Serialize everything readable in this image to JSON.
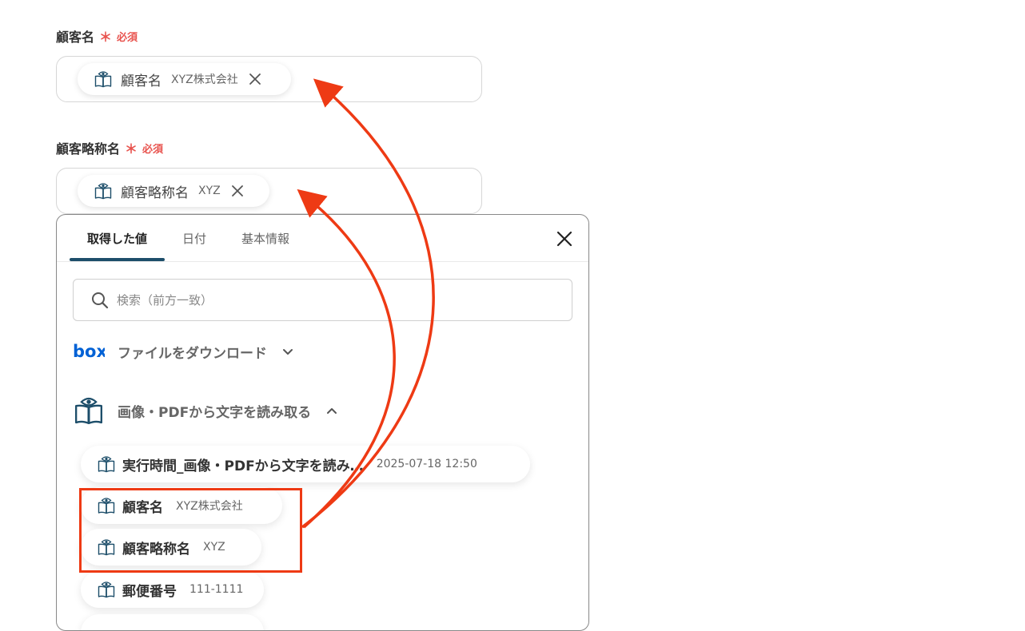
{
  "fields": [
    {
      "label": "顧客名",
      "required_star": "＊",
      "required_text": "必須",
      "token": {
        "name": "顧客名",
        "value": "XYZ株式会社"
      }
    },
    {
      "label": "顧客略称名",
      "required_star": "＊",
      "required_text": "必須",
      "token": {
        "name": "顧客略称名",
        "value": "XYZ"
      }
    }
  ],
  "panel": {
    "tabs": [
      {
        "label": "取得した値",
        "active": true
      },
      {
        "label": "日付",
        "active": false
      },
      {
        "label": "基本情報",
        "active": false
      }
    ],
    "search": {
      "placeholder": "検索（前方一致）",
      "value": ""
    },
    "groups": [
      {
        "logo_text": "box",
        "title": "ファイルをダウンロード",
        "expanded": false
      },
      {
        "title": "画像・PDFから文字を読み取る",
        "expanded": true
      }
    ],
    "items": [
      {
        "name": "実行時間_画像・PDFから文字を読み…",
        "value": "2025-07-18 12:50"
      },
      {
        "name": "顧客名",
        "value": "XYZ株式会社"
      },
      {
        "name": "顧客略称名",
        "value": "XYZ"
      },
      {
        "name": "郵便番号",
        "value": "111-1111"
      }
    ]
  },
  "colors": {
    "required": "#e8534e",
    "tab_indicator": "#1d4e6a",
    "box_brand": "#0061d5",
    "annotation": "#ee3a14"
  },
  "icons": {
    "token": "book-eye-icon",
    "remove": "close-icon",
    "panel_close": "close-icon",
    "search": "search-icon",
    "collapsed": "chevron-down-icon",
    "expanded": "chevron-up-icon"
  }
}
